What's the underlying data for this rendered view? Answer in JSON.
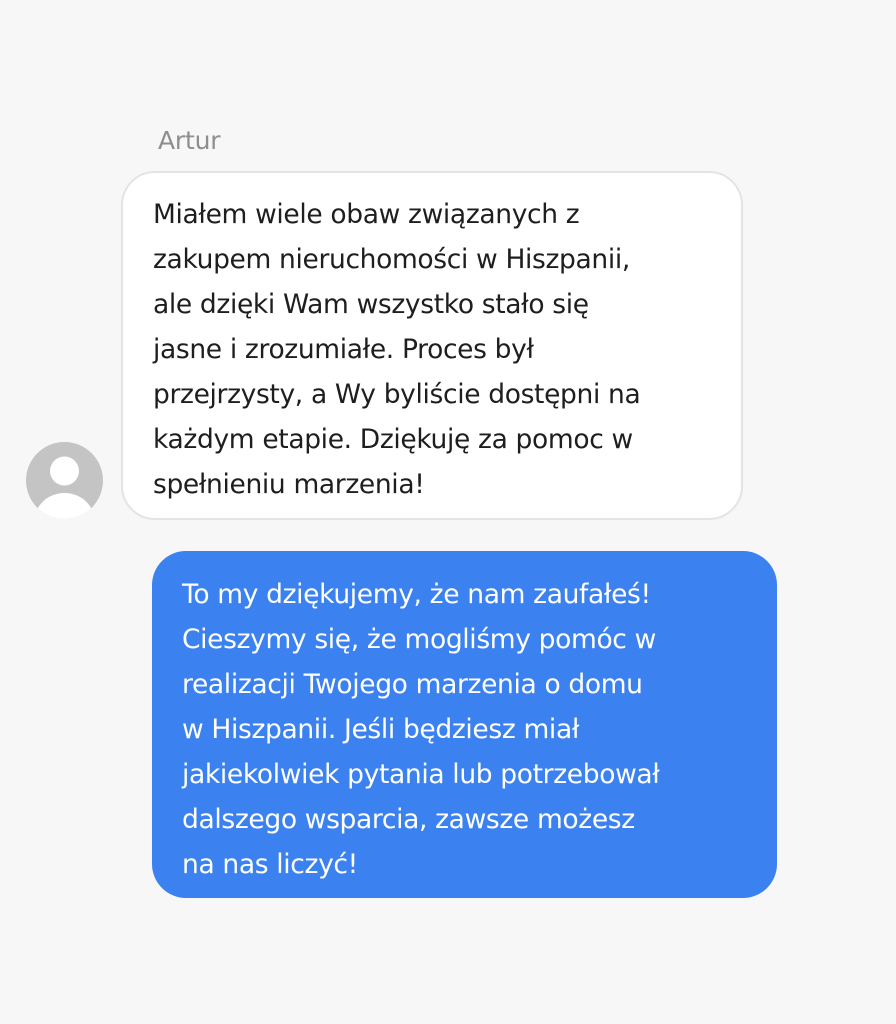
{
  "conversation": {
    "incoming": {
      "sender_name": "Artur",
      "avatar_icon": "default-user-silhouette-icon",
      "message": "Miałem wiele obaw związanych z\nzakupem nieruchomości w Hiszpanii,\nale dzięki Wam wszystko stało się\njasne i zrozumiałe. Proces był\nprzejrzysty, a Wy byliście dostępni na\nkażdym etapie. Dziękuję za pomoc w\nspełnieniu marzenia!",
      "bubble_color": "#ffffff",
      "text_color": "#1e1e1e"
    },
    "outgoing": {
      "message": "To my dziękujemy, że nam zaufałeś!\nCieszymy się, że mogliśmy pomóc w\nrealizacji Twojego marzenia o domu\nw Hiszpanii. Jeśli będziesz miał\njakiekolwiek pytania lub potrzebował\ndalszego wsparcia, zawsze możesz\nna nas liczyć!",
      "bubble_color": "#3b82f0",
      "text_color": "#ffffff"
    }
  },
  "colors": {
    "background": "#f7f7f7",
    "name_text": "#8e8e8e",
    "avatar": "#c4c4c4"
  }
}
